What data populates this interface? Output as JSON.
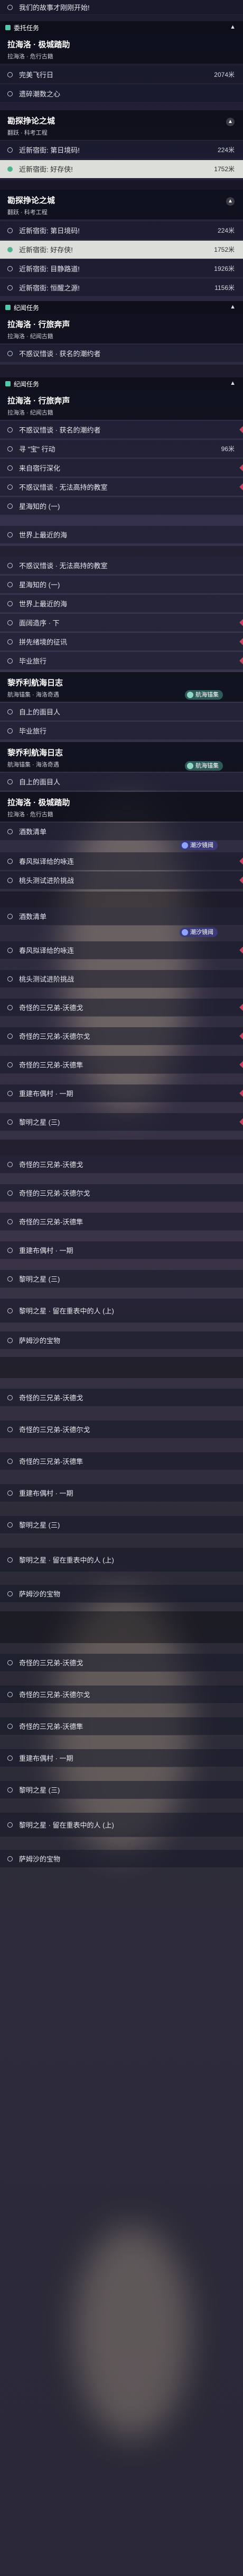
{
  "top_item": "我们的故事才刚刚开始!",
  "sections": [
    {
      "category": "委托任务"
    },
    {
      "category": "纪闻任务"
    }
  ],
  "headers": {
    "h1": {
      "title": "拉海洛 · 极城踏助",
      "subtitle": "拉海洛 · 危行古籍"
    },
    "h2": {
      "title": "勘探挣论之城",
      "subtitle": "翻跃 · 科考工程"
    },
    "h3": {
      "title": "勘探挣论之城",
      "subtitle": "翻跃 · 科考工程"
    },
    "h4": {
      "title": "拉海洛 · 行旅奔声",
      "subtitle": "拉海洛 · 纪闻古籍"
    },
    "h5": {
      "title": "拉海洛 · 行旅奔声",
      "subtitle": "拉海洛 · 纪闻古籍"
    },
    "h6": {
      "title": "黎乔利航海日志",
      "subtitle": "航海锚集 · 海洛奇遇"
    },
    "h7": {
      "title": "黎乔利航海日志",
      "subtitle": "航海锚集 · 海洛奇遇"
    },
    "h8": {
      "title": "拉海洛 · 极城踏助",
      "subtitle": "拉海洛 · 危行古籍"
    }
  },
  "badges": {
    "b1": "航海锚集",
    "b2": "航海锚集",
    "b3": "潮汐镜阈",
    "b4": "潮汐镜阈"
  },
  "items": [
    {
      "text": "完美飞行日",
      "dist": "2074米"
    },
    {
      "text": "遗碎潮数之心",
      "dist": ""
    },
    {
      "text": "近新宿街: 第日境码!",
      "dist": "224米"
    },
    {
      "text": "近新宿街: 好存侠!",
      "dist": "1752米"
    },
    {
      "text": "近新宿街: 第日境码!",
      "dist": "224米"
    },
    {
      "text": "近新宿街: 好存侠!",
      "dist": "1752米"
    },
    {
      "text": "近新宿街: 目静路道!",
      "dist": "1926米"
    },
    {
      "text": "近新宿街: 恒醒之源!",
      "dist": "1156米"
    },
    {
      "text": "不惑议惜谈 · 获名的潮约者",
      "dist": ""
    },
    {
      "text": "不惑议惜谈 · 获名的潮约者",
      "dist": ""
    },
    {
      "text": "寻 \"宝\" 行动",
      "dist": "96米"
    },
    {
      "text": "来自宿行深化",
      "dist": ""
    },
    {
      "text": "不惑议惜谈 · 无法高持的教室",
      "dist": ""
    },
    {
      "text": "星海知的 (一)",
      "dist": ""
    },
    {
      "text": "世界上最近的海",
      "dist": ""
    },
    {
      "text": "不惑议惜谈 · 无法高持的教室",
      "dist": ""
    },
    {
      "text": "星海知的 (一)",
      "dist": ""
    },
    {
      "text": "世界上最近的海",
      "dist": ""
    },
    {
      "text": "面阔造序 · 下",
      "dist": ""
    },
    {
      "text": "拼先绪境的征讯",
      "dist": ""
    },
    {
      "text": "毕业旅行",
      "dist": ""
    },
    {
      "text": "自上的面目人",
      "dist": ""
    },
    {
      "text": "毕业旅行",
      "dist": ""
    },
    {
      "text": "自上的面目人",
      "dist": ""
    },
    {
      "text": "酒数清单",
      "dist": ""
    },
    {
      "text": "春风拟译给的咏连",
      "dist": ""
    },
    {
      "text": "桃头测试进阶挑战",
      "dist": ""
    },
    {
      "text": "酒数清单",
      "dist": ""
    },
    {
      "text": "春风拟译给的咏连",
      "dist": ""
    },
    {
      "text": "桃头测试进阶挑战",
      "dist": ""
    },
    {
      "text": "奇怪的三兄弟-沃德戈",
      "dist": ""
    },
    {
      "text": "奇怪的三兄弟-沃德尔戈",
      "dist": ""
    },
    {
      "text": "奇怪的三兄弟-沃德隼",
      "dist": ""
    },
    {
      "text": "重建布偶村 · 一期",
      "dist": ""
    },
    {
      "text": "黎明之星 (三)",
      "dist": ""
    },
    {
      "text": "奇怪的三兄弟-沃德戈",
      "dist": ""
    },
    {
      "text": "奇怪的三兄弟-沃德尔戈",
      "dist": ""
    },
    {
      "text": "奇怪的三兄弟-沃德隼",
      "dist": ""
    },
    {
      "text": "重建布偶村 · 一期",
      "dist": ""
    },
    {
      "text": "黎明之星 (三)",
      "dist": ""
    },
    {
      "text": "黎明之星 · 留在重表中的人 (上)",
      "dist": ""
    },
    {
      "text": "萨姆沙的宝物",
      "dist": ""
    },
    {
      "text": "奇怪的三兄弟-沃德戈",
      "dist": ""
    },
    {
      "text": "奇怪的三兄弟-沃德尔戈",
      "dist": ""
    },
    {
      "text": "奇怪的三兄弟-沃德隼",
      "dist": ""
    },
    {
      "text": "重建布偶村 · 一期",
      "dist": ""
    },
    {
      "text": "黎明之星 (三)",
      "dist": ""
    },
    {
      "text": "黎明之星 · 留在重表中的人 (上)",
      "dist": ""
    },
    {
      "text": "萨姆沙的宝物",
      "dist": ""
    },
    {
      "text": "奇怪的三兄弟-沃德戈",
      "dist": ""
    },
    {
      "text": "奇怪的三兄弟-沃德尔戈",
      "dist": ""
    },
    {
      "text": "奇怪的三兄弟-沃德隼",
      "dist": ""
    },
    {
      "text": "重建布偶村 · 一期",
      "dist": ""
    },
    {
      "text": "黎明之星 (三)",
      "dist": ""
    },
    {
      "text": "黎明之星 · 留在重表中的人 (上)",
      "dist": ""
    },
    {
      "text": "萨姆沙的宝物",
      "dist": ""
    }
  ],
  "colors": {
    "accent": "#4fb28f",
    "marker": "#c9405a",
    "badge": "#3a3a78"
  }
}
